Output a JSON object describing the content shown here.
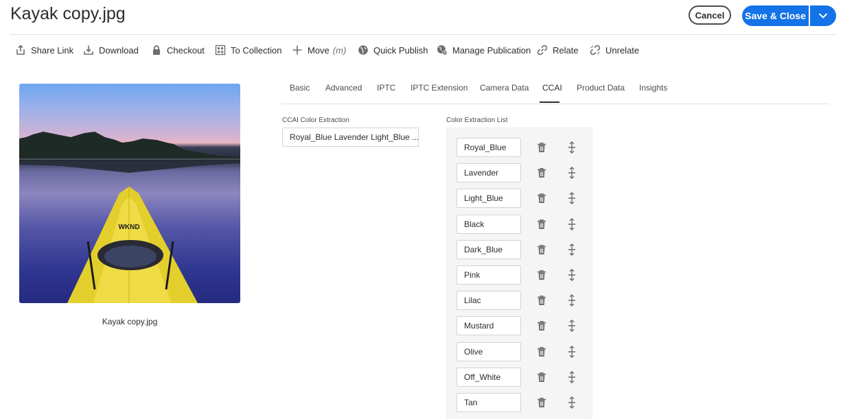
{
  "header": {
    "title": "Kayak copy.jpg",
    "cancel_label": "Cancel",
    "save_close_label": "Save & Close"
  },
  "toolbar": {
    "items": [
      {
        "label": "Share Link",
        "icon": "share-icon"
      },
      {
        "label": "Download",
        "icon": "download-icon"
      },
      {
        "label": "Checkout",
        "icon": "lock-icon"
      },
      {
        "label": "To Collection",
        "icon": "collection-icon"
      },
      {
        "label": "Move",
        "icon": "move-icon",
        "shortcut": "(m)"
      },
      {
        "label": "Quick Publish",
        "icon": "globe-icon"
      },
      {
        "label": "Manage Publication",
        "icon": "globe-gear-icon"
      },
      {
        "label": "Relate",
        "icon": "link-icon"
      },
      {
        "label": "Unrelate",
        "icon": "unlink-icon"
      }
    ]
  },
  "asset": {
    "caption": "Kayak copy.jpg",
    "badge_text": "WKND"
  },
  "tabs": [
    {
      "label": "Basic"
    },
    {
      "label": "Advanced"
    },
    {
      "label": "IPTC"
    },
    {
      "label": "IPTC Extension"
    },
    {
      "label": "Camera Data"
    },
    {
      "label": "CCAI",
      "active": true
    },
    {
      "label": "Product Data"
    },
    {
      "label": "Insights"
    }
  ],
  "ccai": {
    "extraction_label": "CCAI Color Extraction",
    "extraction_value": "Royal_Blue Lavender Light_Blue ...",
    "list_label": "Color Extraction List",
    "colors": [
      "Royal_Blue",
      "Lavender",
      "Light_Blue",
      "Black",
      "Dark_Blue",
      "Pink",
      "Lilac",
      "Mustard",
      "Olive",
      "Off_White",
      "Tan"
    ]
  },
  "colors": {
    "accent": "#1473e6",
    "text": "#2c2c2c",
    "icon": "#6e6e6e"
  }
}
